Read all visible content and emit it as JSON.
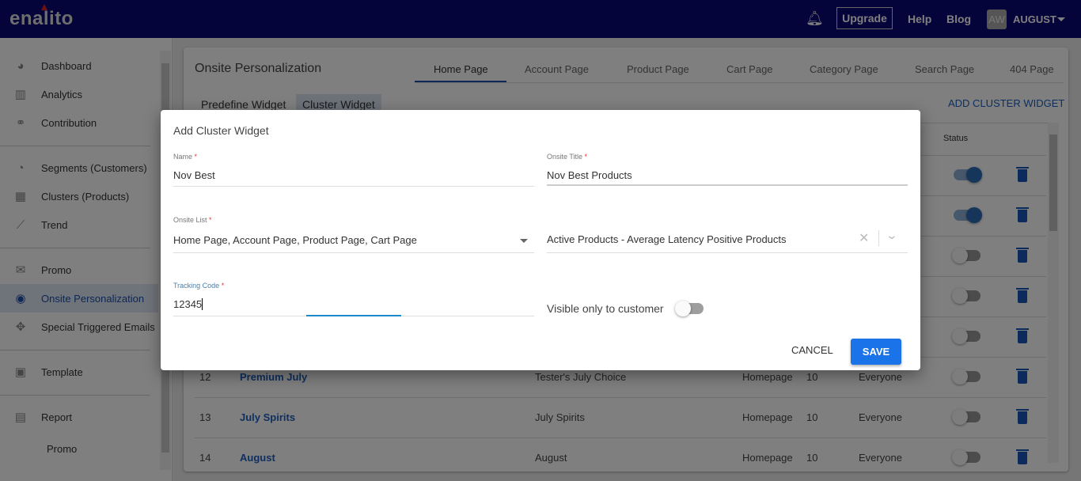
{
  "header": {
    "logo": "enalito",
    "upgrade": "Upgrade",
    "help": "Help",
    "blog": "Blog",
    "avatar_initials": "AW",
    "user": "AUGUST"
  },
  "sidebar": {
    "items": [
      {
        "label": "Dashboard",
        "icon": "dashboard-icon"
      },
      {
        "label": "Analytics",
        "icon": "bar-chart-icon"
      },
      {
        "label": "Contribution",
        "icon": "handshake-icon"
      },
      {
        "label": "Segments (Customers)",
        "icon": "pie-chart-icon"
      },
      {
        "label": "Clusters (Products)",
        "icon": "grid-icon"
      },
      {
        "label": "Trend",
        "icon": "line-chart-icon"
      },
      {
        "label": "Promo",
        "icon": "envelope-icon"
      },
      {
        "label": "Onsite Personalization",
        "icon": "eye-icon",
        "active": true
      },
      {
        "label": "Special Triggered Emails",
        "icon": "crosshair-icon"
      },
      {
        "label": "Template",
        "icon": "image-icon"
      },
      {
        "label": "Report",
        "icon": "document-icon"
      },
      {
        "label": "Promo",
        "icon": ""
      }
    ]
  },
  "main": {
    "title": "Onsite Personalization",
    "tabs": [
      "Home Page",
      "Account Page",
      "Product Page",
      "Cart Page",
      "Category Page",
      "Search Page",
      "404 Page"
    ],
    "subtabs": [
      "Predefine Widget",
      "Cluster Widget"
    ],
    "add_button": "ADD CLUSTER WIDGET",
    "table": {
      "status_header": "Status",
      "hidden_row_status": [
        true,
        true,
        false,
        false,
        false
      ],
      "rows": [
        {
          "num": "12",
          "name": "Premium July",
          "title": "Tester's July Choice",
          "page": "Homepage",
          "count": "10",
          "audience": "Everyone",
          "status": false
        },
        {
          "num": "13",
          "name": "July Spirits",
          "title": "July Spirits",
          "page": "Homepage",
          "count": "10",
          "audience": "Everyone",
          "status": false
        },
        {
          "num": "14",
          "name": "August",
          "title": "August",
          "page": "Homepage",
          "count": "10",
          "audience": "Everyone",
          "status": false
        }
      ]
    }
  },
  "modal": {
    "title": "Add Cluster Widget",
    "name_label": "Name",
    "name_value": "Nov Best",
    "onsite_title_label": "Onsite Title",
    "onsite_title_value": "Nov Best Products",
    "onsite_list_label": "Onsite List",
    "onsite_list_value": "Home Page, Account Page, Product Page, Cart Page",
    "cluster_value": "Active Products - Average Latency Positive Products",
    "tracking_label": "Tracking Code",
    "tracking_value": "12345",
    "visible_label": "Visible only to customer",
    "visible_on": false,
    "required_mark": "*",
    "cancel": "CANCEL",
    "save": "SAVE"
  }
}
